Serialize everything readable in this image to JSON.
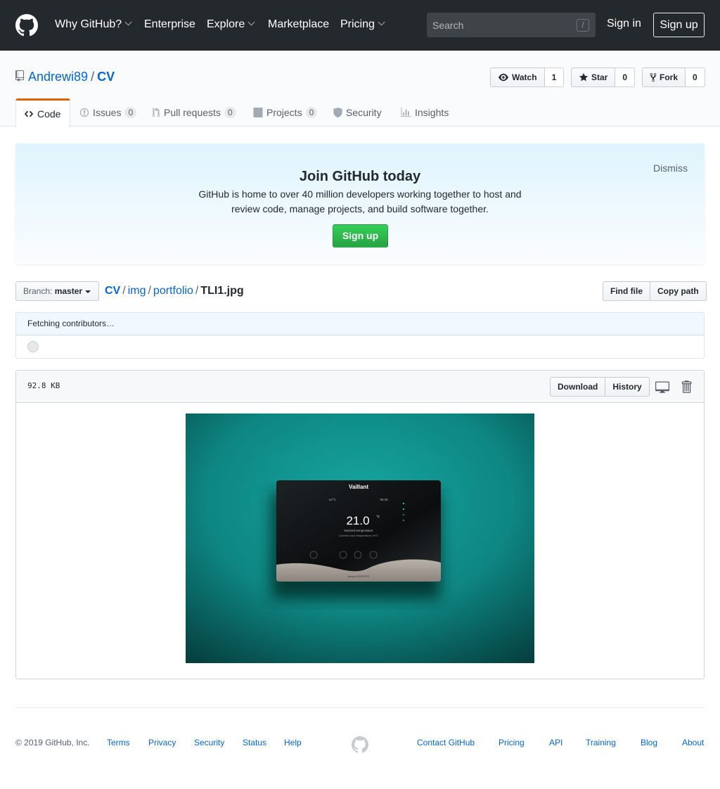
{
  "header": {
    "nav": [
      {
        "label": "Why GitHub?",
        "dropdown": true
      },
      {
        "label": "Enterprise",
        "dropdown": false
      },
      {
        "label": "Explore",
        "dropdown": true
      },
      {
        "label": "Marketplace",
        "dropdown": false
      },
      {
        "label": "Pricing",
        "dropdown": true
      }
    ],
    "search_placeholder": "Search",
    "search_key": "/",
    "sign_in": "Sign in",
    "sign_up": "Sign up"
  },
  "repo": {
    "owner": "Andrewi89",
    "separator": "/",
    "name": "CV",
    "watch_label": "Watch",
    "watch_count": "1",
    "star_label": "Star",
    "star_count": "0",
    "fork_label": "Fork",
    "fork_count": "0"
  },
  "tabs": [
    {
      "label": "Code"
    },
    {
      "label": "Issues",
      "count": "0"
    },
    {
      "label": "Pull requests",
      "count": "0"
    },
    {
      "label": "Projects",
      "count": "0"
    },
    {
      "label": "Security"
    },
    {
      "label": "Insights"
    }
  ],
  "banner": {
    "title": "Join GitHub today",
    "text": "GitHub is home to over 40 million developers working together to host and review code, manage projects, and build software together.",
    "button": "Sign up",
    "dismiss": "Dismiss"
  },
  "file_nav": {
    "branch_prefix": "Branch:",
    "branch": "master",
    "path": [
      "CV",
      "img",
      "portfolio"
    ],
    "path_sep": "/",
    "file": "TLI1.jpg",
    "find_file": "Find file",
    "copy_path": "Copy path"
  },
  "commit": {
    "status": "Fetching contributors…"
  },
  "file": {
    "size": "92.8 KB",
    "download": "Download",
    "history": "History"
  },
  "image": {
    "brand": "Vaillant",
    "outdoor_temp": "-12°C",
    "time": "06:30",
    "temperature": "21.0",
    "unit": "°C",
    "caption1": "Desired temperature",
    "caption2": "Current room temperature 19°C",
    "product": "sensoCOMFORT"
  },
  "footer": {
    "copyright": "© 2019 GitHub, Inc.",
    "links_left": [
      "Terms",
      "Privacy",
      "Security",
      "Status",
      "Help"
    ],
    "links_right": [
      "Contact GitHub",
      "Pricing",
      "API",
      "Training",
      "Blog",
      "About"
    ]
  },
  "colors": {
    "header_bg": "#24292e",
    "link": "#0366d6",
    "signup_green": "#28a745",
    "tab_accent": "#e36209",
    "teal_wall": "#0f8a86"
  }
}
